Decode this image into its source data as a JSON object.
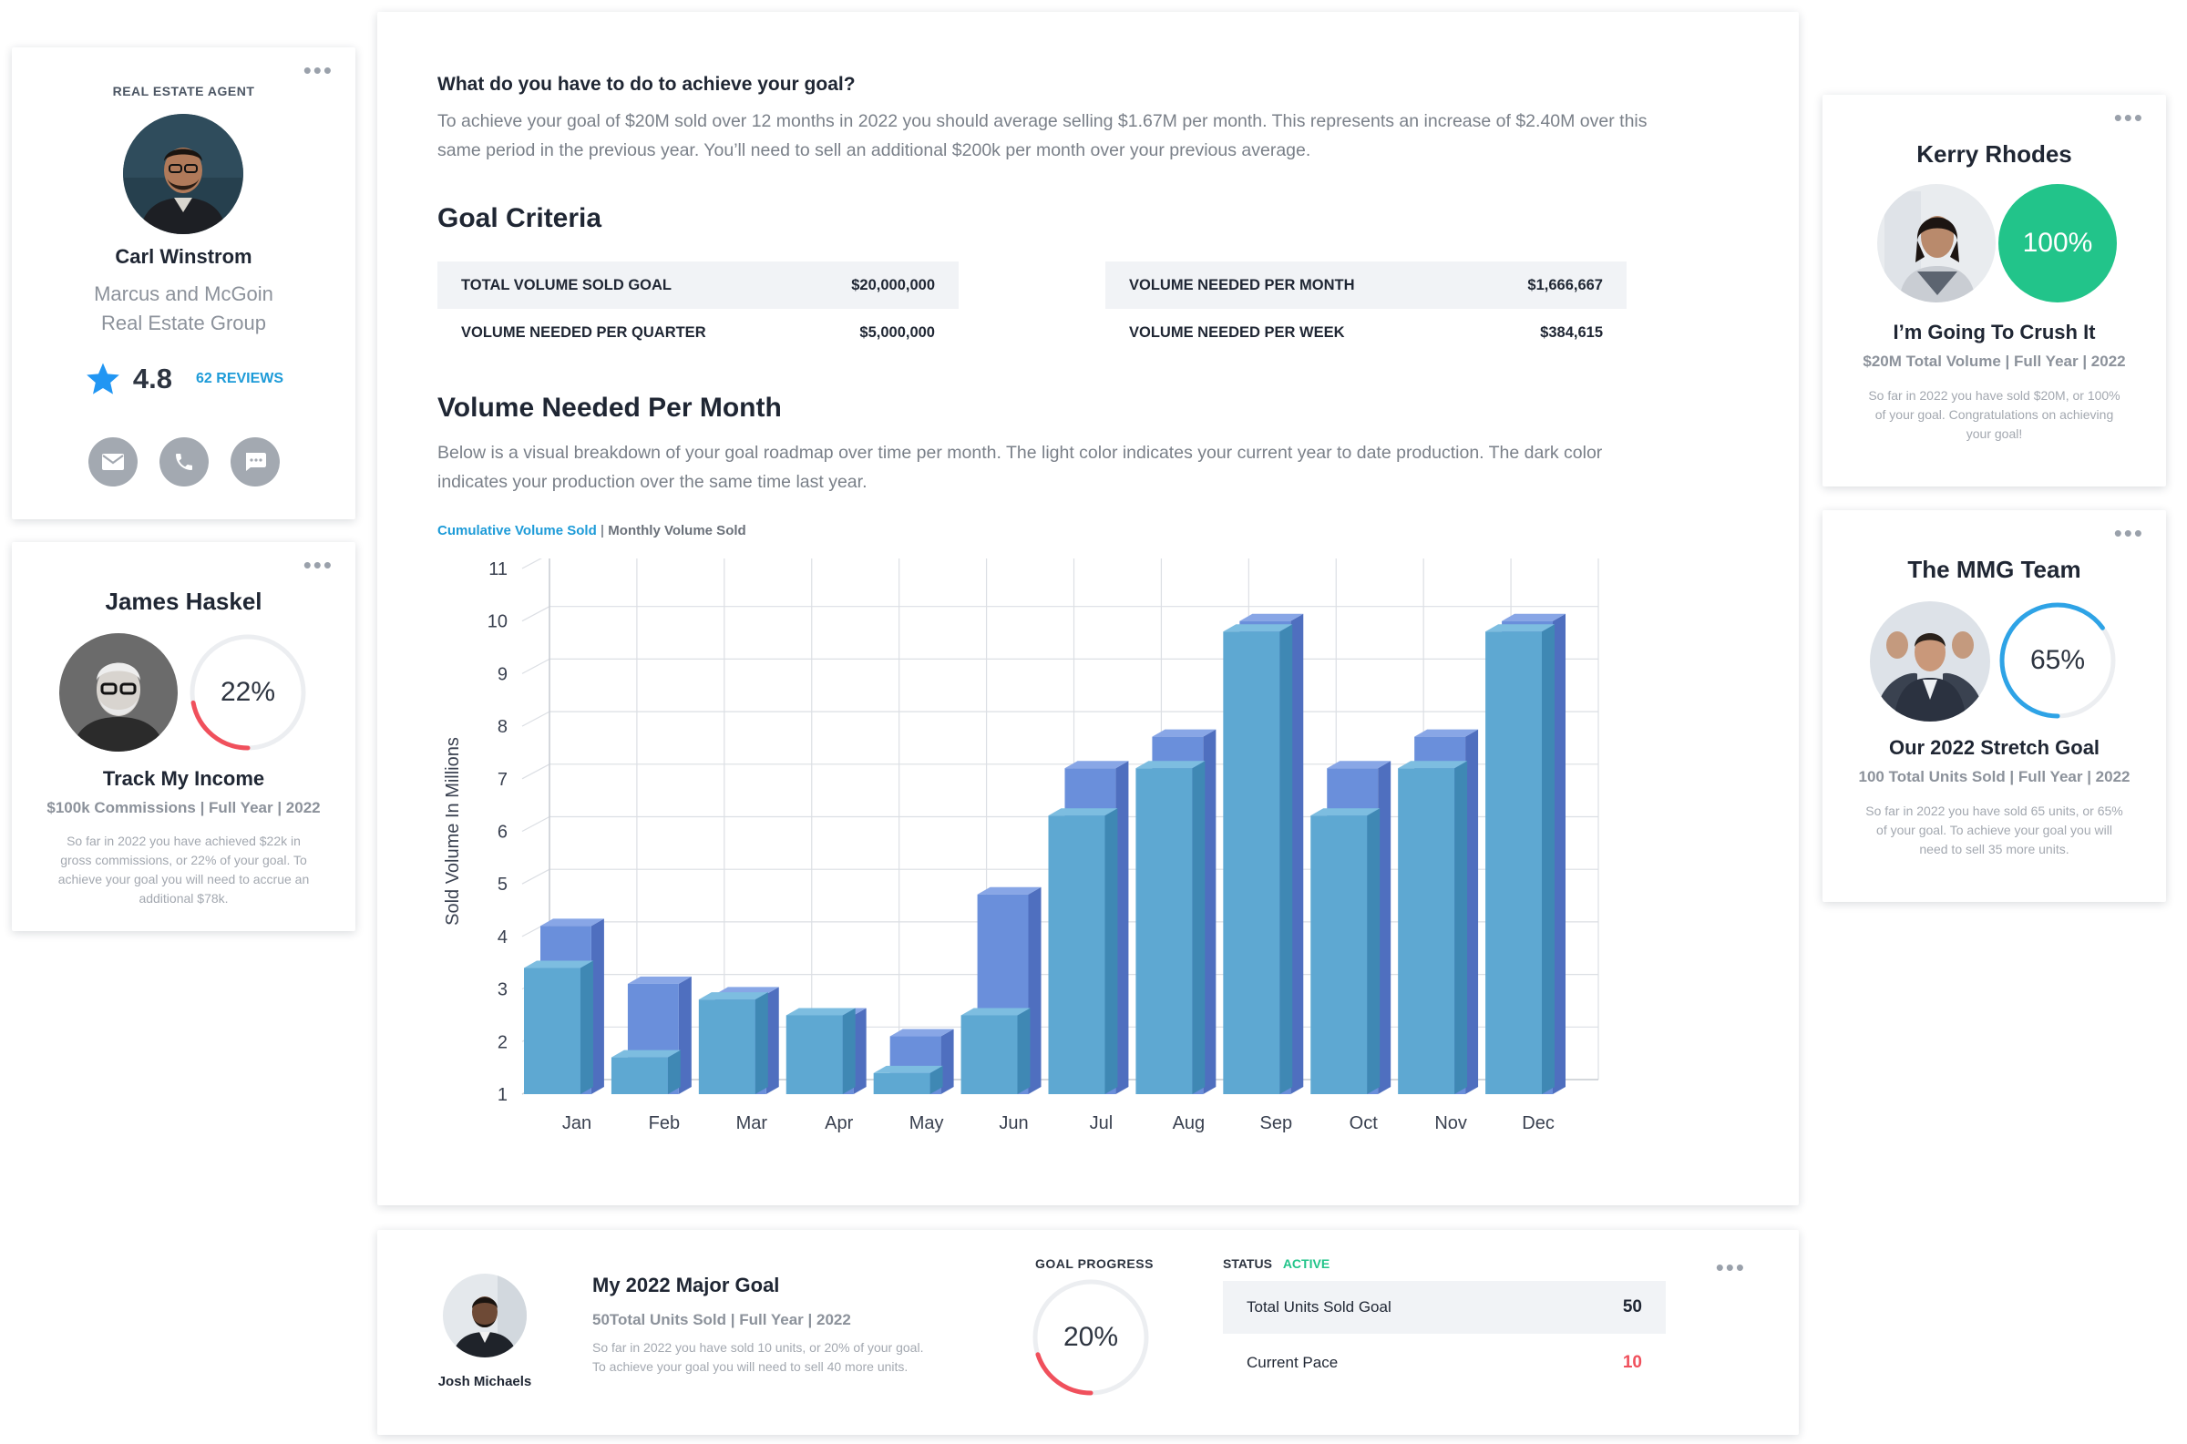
{
  "agent_card": {
    "role": "REAL ESTATE AGENT",
    "name": "Carl Winstrom",
    "company_line1": "Marcus and McGoin",
    "company_line2": "Real Estate Group",
    "rating": "4.8",
    "reviews": "62 REVIEWS",
    "contacts": [
      "email-icon",
      "phone-icon",
      "chat-icon"
    ]
  },
  "income_card": {
    "name": "James Haskel",
    "percent": "22%",
    "progress": 0.22,
    "goal_title": "Track My Income",
    "goal_meta": "$100k Commissions | Full Year | 2022",
    "desc_lines": [
      "So far in 2022 you have achieved $22k in",
      "gross commissions, or 22% of your goal. To",
      "achieve your goal you will need to accrue an",
      "additional $78k."
    ]
  },
  "kerry_card": {
    "name": "Kerry Rhodes",
    "percent": "100%",
    "progress": 1.0,
    "goal_title": "I’m Going To Crush It",
    "goal_meta": "$20M Total Volume | Full Year | 2022",
    "desc_lines": [
      "So far in 2022 you have sold $20M, or 100%",
      "of your goal. Congratulations on achieving",
      "your goal!"
    ]
  },
  "team_card": {
    "name": "The MMG Team",
    "percent": "65%",
    "progress": 0.65,
    "goal_title": "Our 2022 Stretch Goal",
    "goal_meta": "100 Total Units Sold | Full Year | 2022",
    "desc_lines": [
      "So far in 2022 you have sold 65 units, or 65%",
      "of your goal. To achieve your goal you will",
      "need to sell 35 more units."
    ]
  },
  "main": {
    "question": "What do you have to do to achieve your goal?",
    "intro_line1": "To achieve your goal of $20M sold over 12 months in 2022 you should average selling $1.67M per month.  This represents an increase of $2.40M over this",
    "intro_line2": "same period in the previous year.  You’ll need to sell an additional $200k per month over your previous average.",
    "criteria_title": "Goal Criteria",
    "criteria": [
      {
        "label": "TOTAL VOLUME SOLD GOAL",
        "value": "$20,000,000"
      },
      {
        "label": "VOLUME NEEDED PER QUARTER",
        "value": "$5,000,000"
      },
      {
        "label": "VOLUME NEEDED PER MONTH",
        "value": "$1,666,667"
      },
      {
        "label": "VOLUME NEEDED PER WEEK",
        "value": "$384,615"
      }
    ],
    "chart_title": "Volume Needed Per Month",
    "chart_desc_line1": "Below is a visual breakdown of your goal roadmap over time per month.  The light color indicates your current year to date production.  The dark color",
    "chart_desc_line2": "indicates your production over the same time last year.",
    "tab_active": "Cumulative Volume Sold",
    "tab_separator": "|",
    "tab_inactive": "Monthly Volume Sold"
  },
  "chart_data": {
    "type": "bar",
    "ylabel": "Sold Volume In Millions",
    "xlabel": "",
    "ylim": [
      1,
      11
    ],
    "yticks": [
      1,
      2,
      3,
      4,
      5,
      6,
      7,
      8,
      9,
      10,
      11
    ],
    "categories": [
      "Jan",
      "Feb",
      "Mar",
      "Apr",
      "May",
      "Jun",
      "Jul",
      "Aug",
      "Sep",
      "Oct",
      "Nov",
      "Dec"
    ],
    "series": [
      {
        "values": [
          4.2,
          3.1,
          2.9,
          2.5,
          2.1,
          4.8,
          7.2,
          7.8,
          10.0,
          7.2,
          7.8,
          10.0
        ],
        "color": "#6a8fdb"
      },
      {
        "values": [
          3.4,
          1.7,
          2.8,
          2.5,
          1.4,
          2.5,
          6.3,
          7.2,
          9.8,
          6.3,
          7.2,
          9.8
        ],
        "color": "#5ea8d2"
      }
    ],
    "grid": true,
    "style": "3d"
  },
  "bottom_card": {
    "person_name": "Josh Michaels",
    "goal_title": "My 2022 Major Goal",
    "goal_meta": "50Total Units Sold | Full Year | 2022",
    "desc_line1": "So far in 2022 you have sold 10 units, or 20% of your goal.",
    "desc_line2": "To achieve your goal you will need to sell 40 more units.",
    "progress_label": "GOAL PROGRESS",
    "percent": "20%",
    "progress": 0.2,
    "status_label": "STATUS",
    "status_value": "ACTIVE",
    "rows": [
      {
        "label": "Total Units Sold Goal",
        "value": "50"
      },
      {
        "label": "Current Pace",
        "value": "10"
      }
    ]
  },
  "colors": {
    "accent_blue": "#1d9bd8",
    "success_green": "#22c48a",
    "danger_red": "#f0505c",
    "ring_blue": "#2ea3e6",
    "star_blue": "#2196f3"
  }
}
